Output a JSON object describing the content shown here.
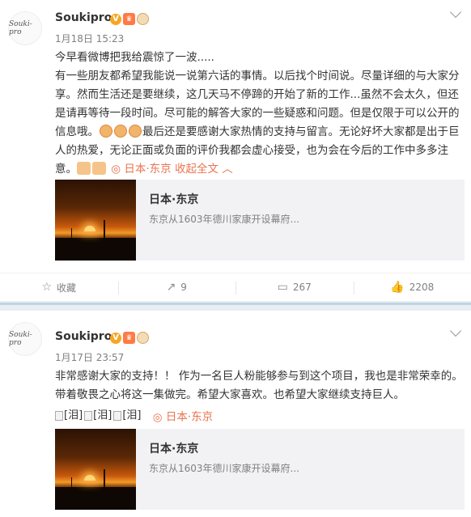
{
  "posts": [
    {
      "username": "Soukipro",
      "avatar_text": "Souki-pro",
      "timestamp": "1月18日 15:23",
      "text_parts": {
        "line1": "今早看微博把我给震惊了一波.....",
        "para_a": "有一些朋友都希望我能说一说第六话的事情。以后找个时间说。尽量详细的与大家分享。然而生活还是要继续，这几天马不停蹄的开始了新的工作...虽然不会太久，但还是请再等待一段时间。尽可能的解答大家的一些疑惑和问题。但是仅限于可以公开的信息哦。",
        "para_b": "最后还是要感谢大家热情的支持与留言。无论好坏大家都是出于巨人的热爱，无论正面或负面的评价我都会虚心接受，也为会在今后的工作中多多注意。",
        "location": "日本·东京",
        "collapse_label": "收起全文"
      },
      "card": {
        "title": "日本·东京",
        "description": "东京从1603年德川家康开设幕府..."
      },
      "actions": {
        "favorite": "收藏",
        "repost": "9",
        "comment": "267",
        "like": "2208"
      }
    },
    {
      "username": "Soukipro",
      "avatar_text": "Souki-pro",
      "timestamp": "1月17日 23:57",
      "text": "非常感谢大家的支持！！ 作为一名巨人粉能够参与到这个项目，我也是非常荣幸的。带着敬畏之心将这一集做完。希望大家喜欢。也希望大家继续支持巨人。",
      "image_alts": [
        "[泪]",
        "[泪]",
        "[泪]"
      ],
      "location": "日本·东京",
      "card": {
        "title": "日本·东京",
        "description": "东京从1603年德川家康开设幕府..."
      }
    }
  ],
  "icons": {
    "verified": "V",
    "favorite": "☆",
    "repost": "↗",
    "comment": "▭",
    "like": "👍",
    "location": "◎"
  },
  "colors": {
    "accent": "#eb7350",
    "muted": "#808080",
    "divider": "#bcd5e4"
  }
}
